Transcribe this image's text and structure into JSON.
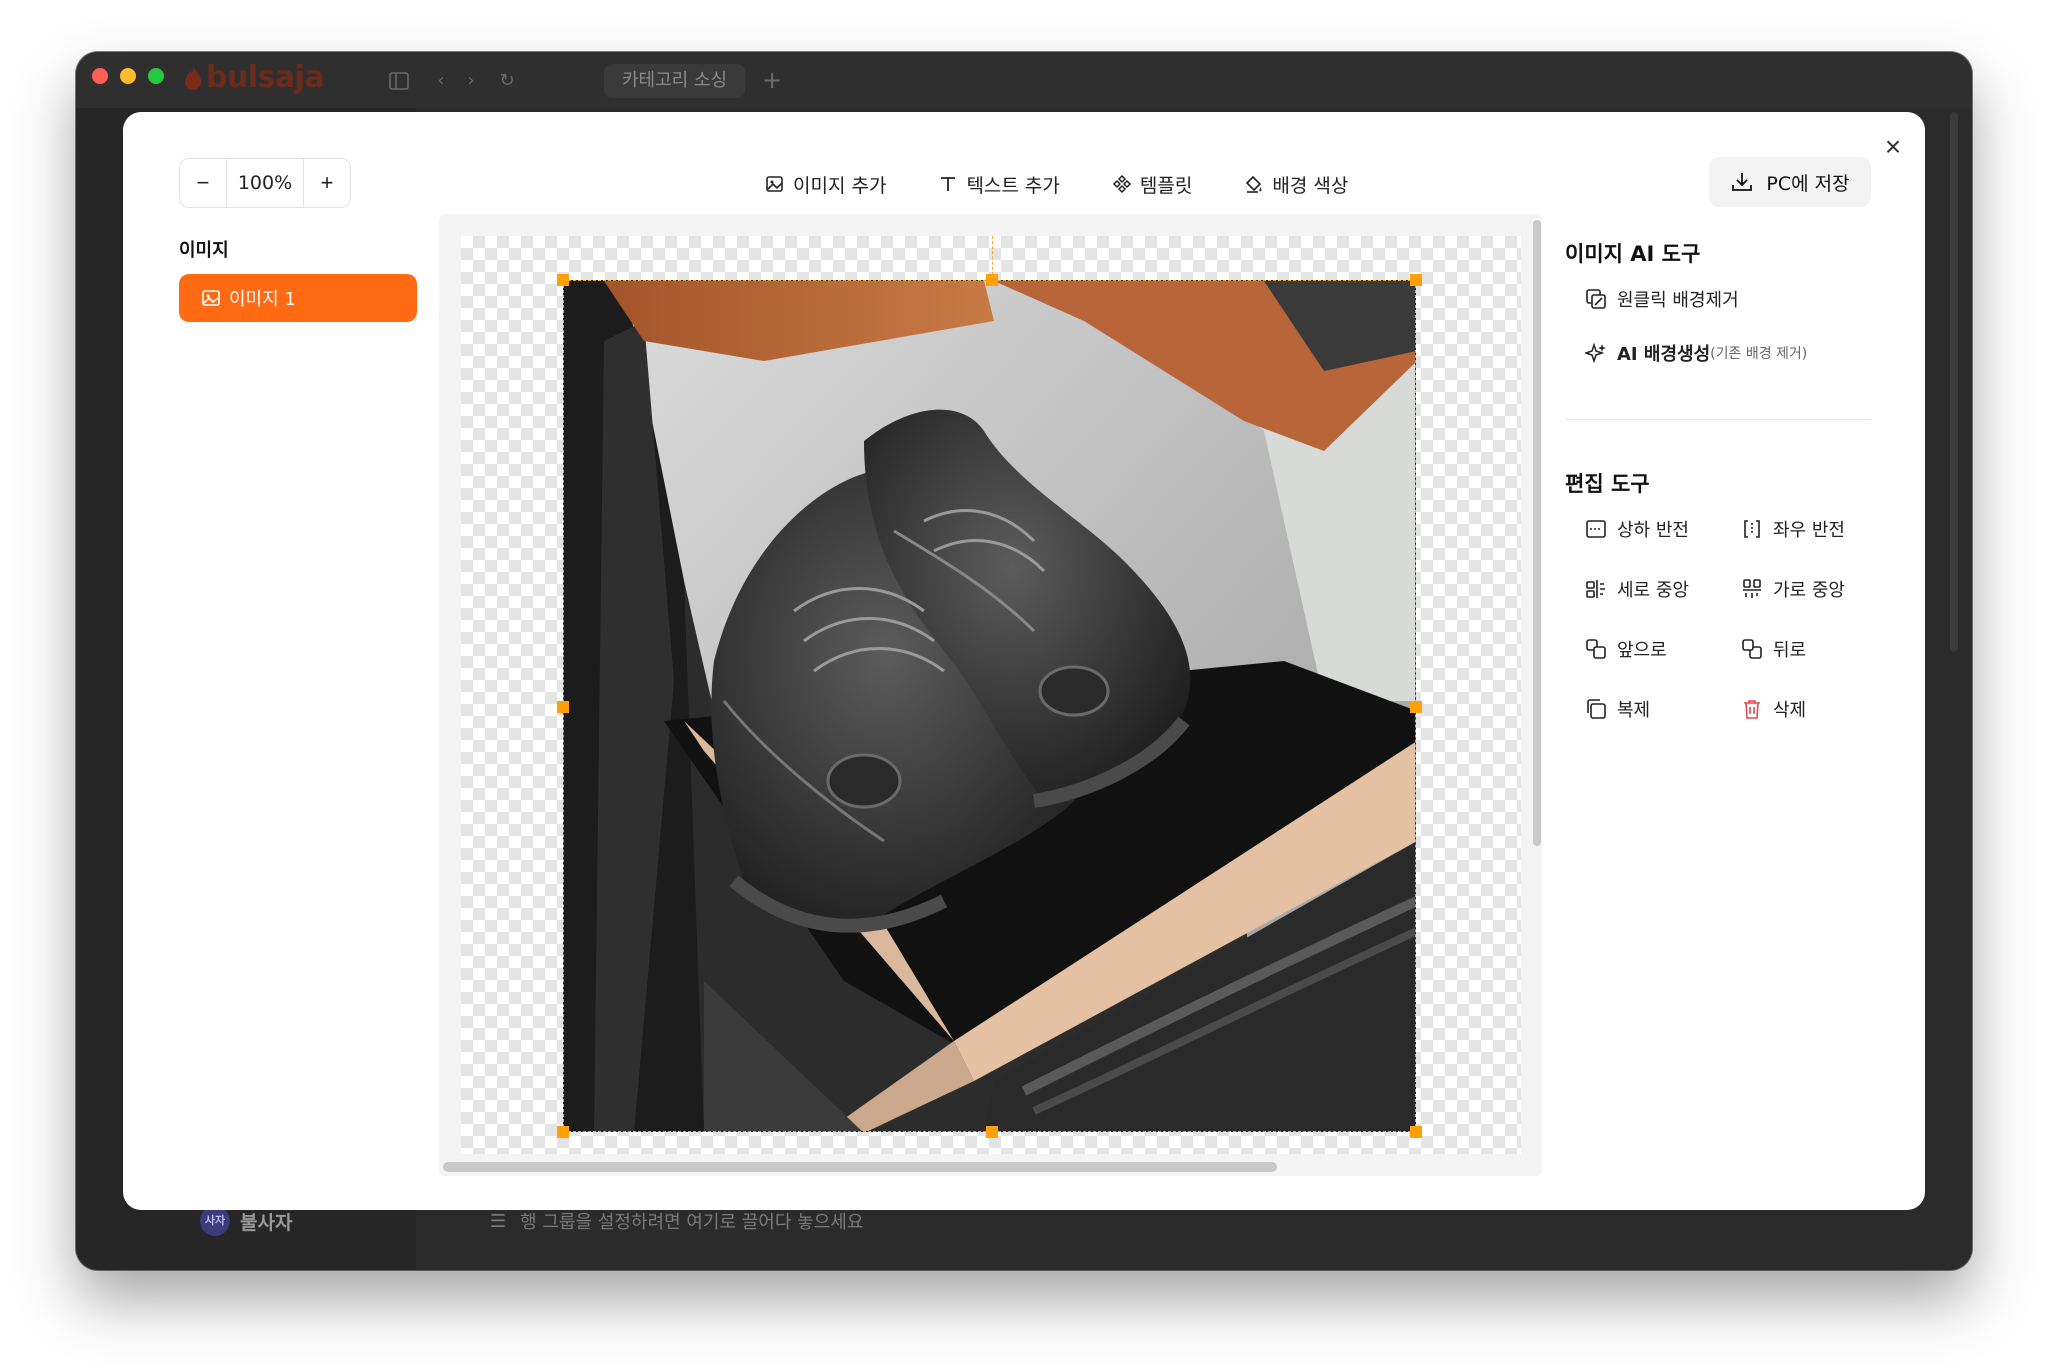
{
  "titlebar": {
    "brand": "bulsaja",
    "tab_label": "카테고리 소싱",
    "new_tab_symbol": "+"
  },
  "background": {
    "user_avatar": "사자",
    "user_name": "불사자",
    "group_hint": "행 그룹을 설정하려면 여기로 끌어다 놓으세요"
  },
  "editor": {
    "zoom": {
      "minus": "−",
      "value": "100%",
      "plus": "+"
    },
    "toolbar": {
      "add_image": "이미지 추가",
      "add_text": "텍스트 추가",
      "template": "템플릿",
      "bg_color": "배경 색상"
    },
    "save_label": "PC에 저장",
    "close_symbol": "×",
    "layers": {
      "title": "이미지",
      "items": [
        "이미지 1"
      ]
    },
    "ai_tools": {
      "title": "이미지 AI 도구",
      "remove_bg": "원클릭 배경제거",
      "ai_bg": "AI 배경생성",
      "ai_bg_note": "(기존 배경 제거)"
    },
    "edit_tools": {
      "title": "편집 도구",
      "flip_v": "상하 반전",
      "flip_h": "좌우 반전",
      "center_v": "세로 중앙",
      "center_h": "가로 중앙",
      "forward": "앞으로",
      "backward": "뒤로",
      "duplicate": "복제",
      "delete": "삭제"
    },
    "colors": {
      "accent": "#ff6a13",
      "handle": "#ff9f0a",
      "delete_icon": "#e5484d"
    }
  }
}
